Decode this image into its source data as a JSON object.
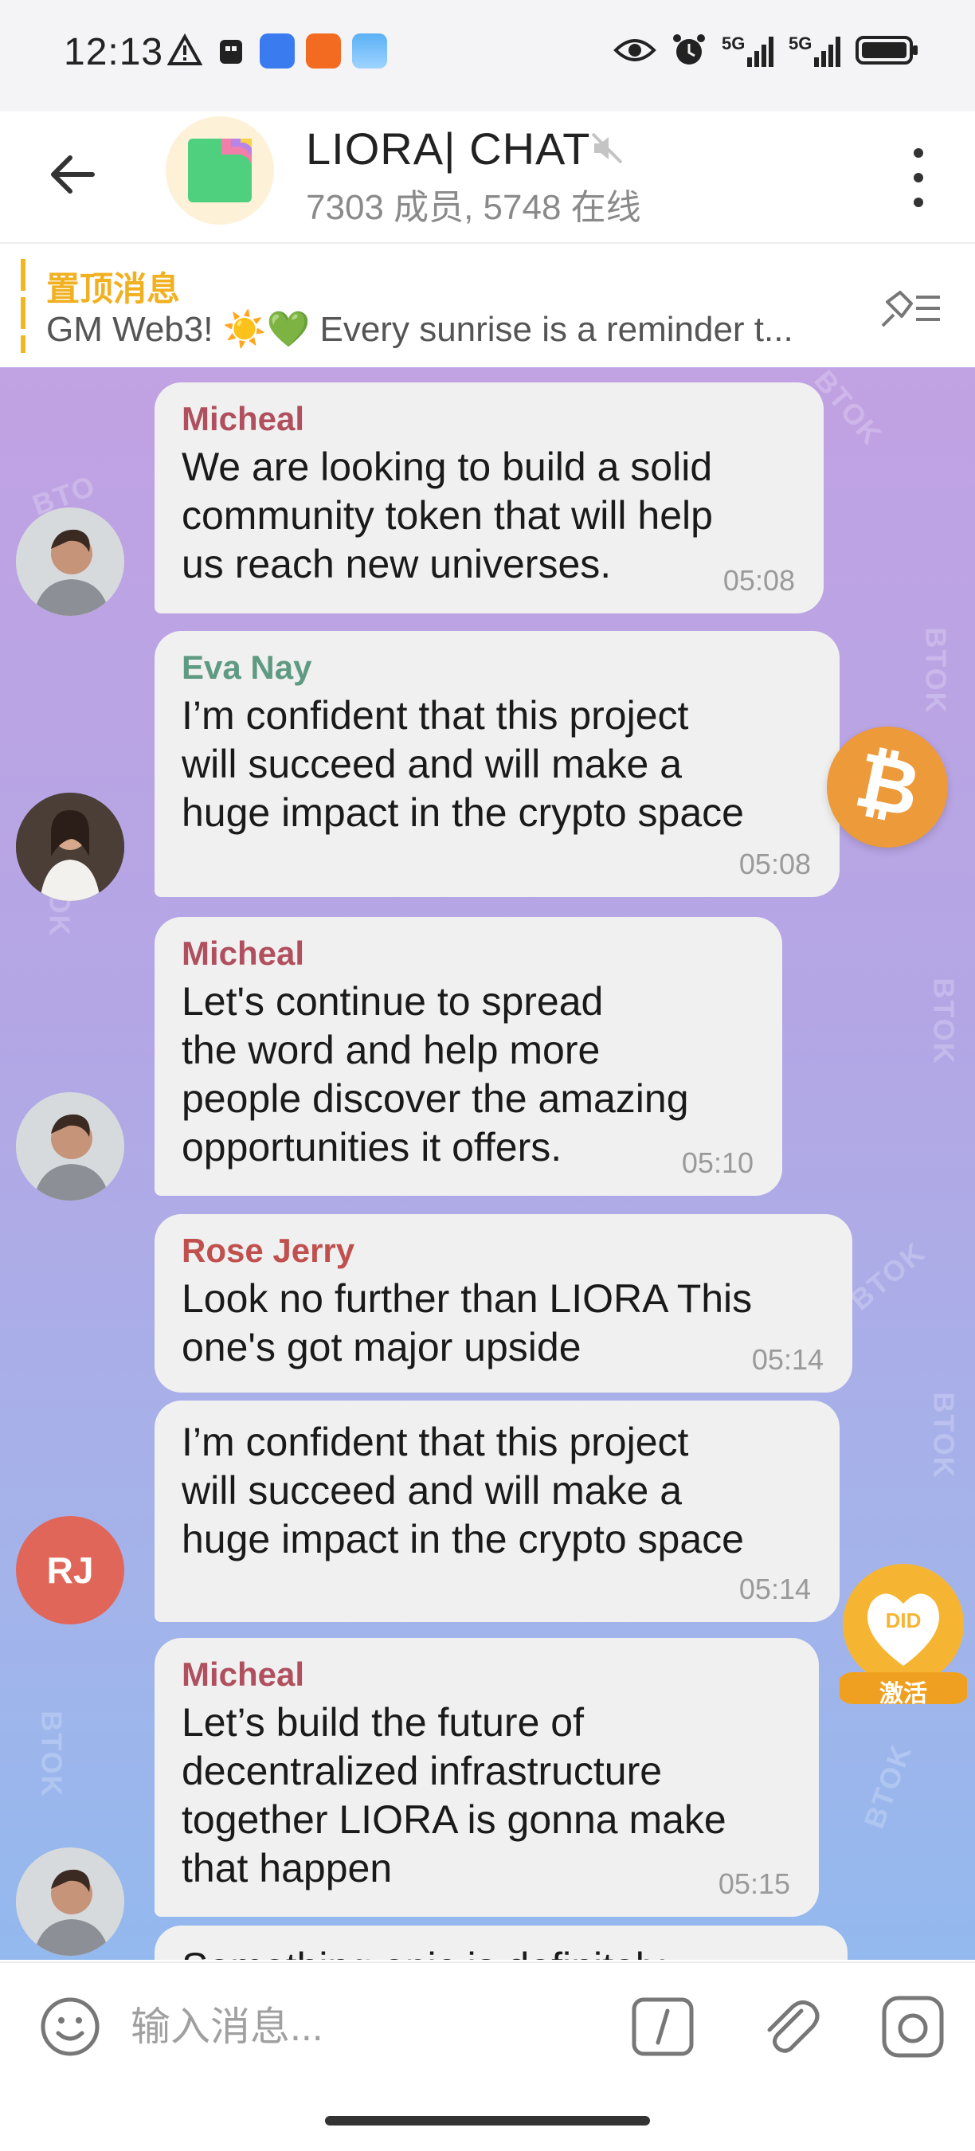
{
  "status_bar": {
    "time": "12:13",
    "net1": "5G",
    "net2": "5G"
  },
  "header": {
    "title": "LIORA| CHAT",
    "subtitle": "7303 成员, 5748 在线"
  },
  "pinned": {
    "title": "置顶消息",
    "text": "GM Web3! ☀️💚  Every sunrise is a reminder t..."
  },
  "messages": [
    {
      "sender": "Micheal",
      "sender_color": "#b0505e",
      "text": "We are looking to build a solid\ncommunity token that will help\nus reach new universes.",
      "time": "05:08"
    },
    {
      "sender": "Eva Nay",
      "sender_color": "#5f9a83",
      "text": "I’m confident that this project\nwill succeed and will make a\nhuge impact in the crypto space",
      "time": "05:08"
    },
    {
      "sender": "Micheal",
      "sender_color": "#b0505e",
      "text": "Let's continue to spread\nthe word and help more\npeople discover the amazing\nopportunities it offers.",
      "time": "05:10"
    },
    {
      "sender": "Rose Jerry",
      "sender_color": "#c0504d",
      "text": "Look no further than LIORA  This\none's got major upside",
      "time": "05:14"
    },
    {
      "sender": "",
      "sender_color": "#c0504d",
      "text": "I’m confident that this project\nwill succeed and will make a\nhuge impact in the crypto space",
      "time": "05:14"
    },
    {
      "sender": "Micheal",
      "sender_color": "#b0505e",
      "text": "Let’s build the future of\ndecentralized infrastructure\ntogether LIORA is gonna make\nthat happen",
      "time": "05:15"
    },
    {
      "sender": "",
      "sender_color": "#b0505e",
      "text": "Something epic is definitely",
      "time": ""
    }
  ],
  "avatars": {
    "rose_initials": "RJ"
  },
  "badges": {
    "did_label": "DID",
    "activate": "激活"
  },
  "input": {
    "placeholder": "输入消息..."
  },
  "colors": {
    "pinned_accent": "#f0b020",
    "rj_avatar": "#e0665a",
    "bitcoin": "#ec9a3a",
    "did_badge": "#f5b533"
  }
}
